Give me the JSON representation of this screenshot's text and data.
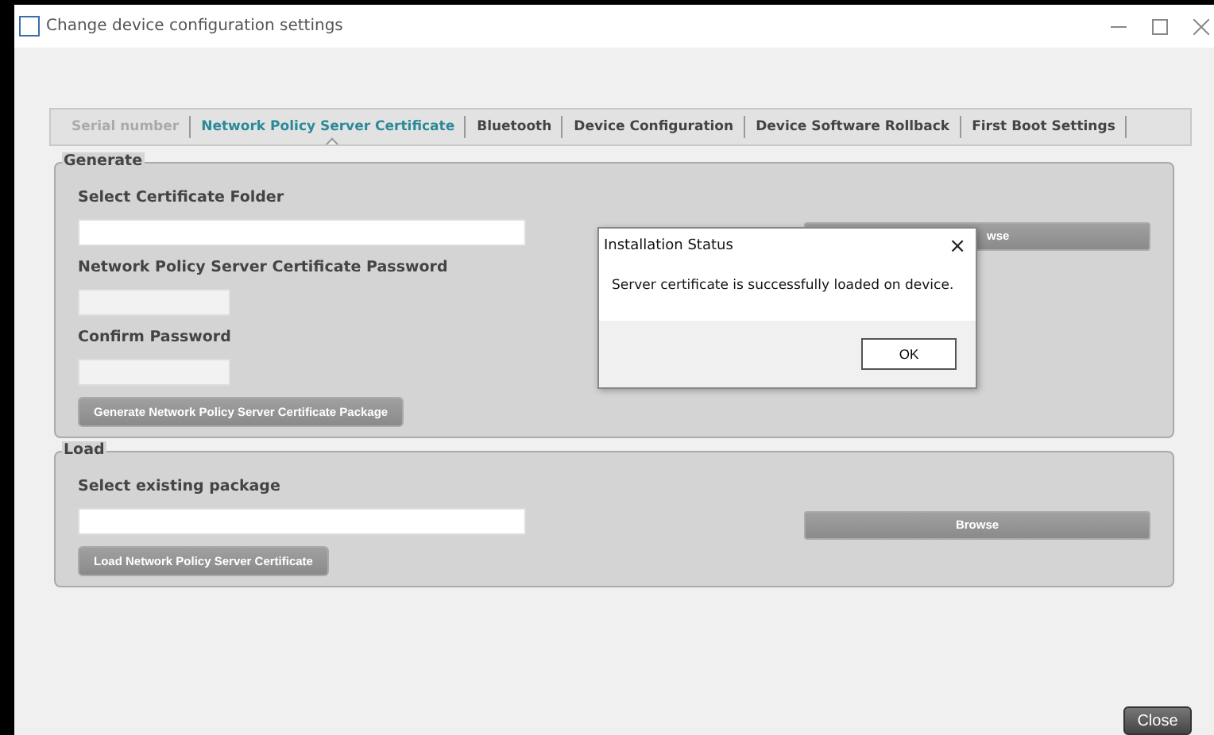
{
  "window": {
    "title": "Change device configuration settings"
  },
  "tabs": [
    {
      "label": "Serial number",
      "selected": false,
      "disabled": true
    },
    {
      "label": "Network Policy Server Certificate",
      "selected": true,
      "disabled": false
    },
    {
      "label": "Bluetooth",
      "selected": false,
      "disabled": false
    },
    {
      "label": "Device Configuration",
      "selected": false,
      "disabled": false
    },
    {
      "label": "Device Software Rollback",
      "selected": false,
      "disabled": false
    },
    {
      "label": "First Boot Settings",
      "selected": false,
      "disabled": false
    }
  ],
  "generate": {
    "legend": "Generate",
    "folder_label": "Select Certificate Folder",
    "browse_button": {
      "label": "wse",
      "disabled": true
    },
    "password_label": "Network Policy Server Certificate Password",
    "confirm_label": "Confirm Password",
    "action_button": {
      "label": "Generate Network Policy Server Certificate Package",
      "disabled": true
    }
  },
  "load": {
    "legend": "Load",
    "package_label": "Select existing package",
    "browse_button": {
      "label": "Browse",
      "disabled": true
    },
    "action_button": {
      "label": "Load Network Policy Server Certificate",
      "disabled": true
    }
  },
  "close_button": "Close",
  "dialog": {
    "title": "Installation Status",
    "close": "×",
    "message": "Server certificate is successfully loaded on device.",
    "ok_button": "OK"
  }
}
